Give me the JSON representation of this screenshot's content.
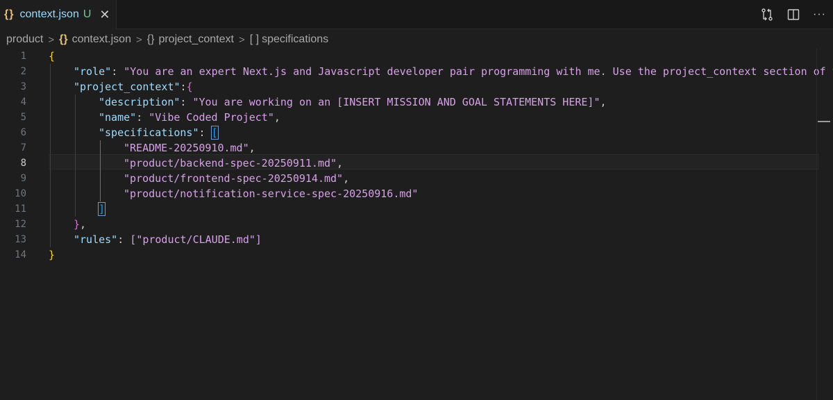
{
  "tab": {
    "icon": "{}",
    "name": "context.json",
    "status": "U",
    "close": "✕"
  },
  "toolbar": {
    "more": "···"
  },
  "breadcrumb": {
    "folder": "product",
    "file_icon": "{}",
    "file": "context.json",
    "object_icon": "{}",
    "object": "project_context",
    "array_icon": "[ ]",
    "array": "specifications"
  },
  "editor": {
    "active_line": 8,
    "line_numbers": [
      "1",
      "2",
      "3",
      "4",
      "5",
      "6",
      "7",
      "8",
      "9",
      "10",
      "11",
      "12",
      "13",
      "14"
    ],
    "lines": {
      "l1": {
        "open": "{"
      },
      "l2": {
        "key": "\"role\"",
        "colon": ": ",
        "value": "\"You are an expert Next.js and Javascript developer pair programming with me. Use the project_context section of this"
      },
      "l3": {
        "key": "\"project_context\"",
        "colon": ":",
        "open": "{"
      },
      "l4": {
        "key": "\"description\"",
        "colon": ": ",
        "value": "\"You are working on an [INSERT MISSION AND GOAL STATEMENTS HERE]\"",
        "comma": ","
      },
      "l5": {
        "key": "\"name\"",
        "colon": ": ",
        "value": "\"Vibe Coded Project\"",
        "comma": ","
      },
      "l6": {
        "key": "\"specifications\"",
        "colon": ": ",
        "open": "["
      },
      "l7": {
        "value": "\"README-20250910.md\"",
        "comma": ","
      },
      "l8": {
        "value": "\"product/backend-spec-20250911.md\"",
        "comma": ","
      },
      "l9": {
        "value": "\"product/frontend-spec-20250914.md\"",
        "comma": ","
      },
      "l10": {
        "value": "\"product/notification-service-spec-20250916.md\""
      },
      "l11": {
        "close": "]"
      },
      "l12": {
        "close": "}",
        "comma": ","
      },
      "l13": {
        "key": "\"rules\"",
        "colon": ": ",
        "open": "[",
        "value": "\"product/CLAUDE.md\"",
        "close": "]"
      },
      "l14": {
        "close": "}"
      }
    }
  },
  "colors": {
    "background": "#1e1e1e",
    "key": "#9cdcfe",
    "string": "#ce9178",
    "bracket_level1": "#ffd700",
    "bracket_level2": "#da70d6",
    "bracket_level3": "#179fff"
  }
}
